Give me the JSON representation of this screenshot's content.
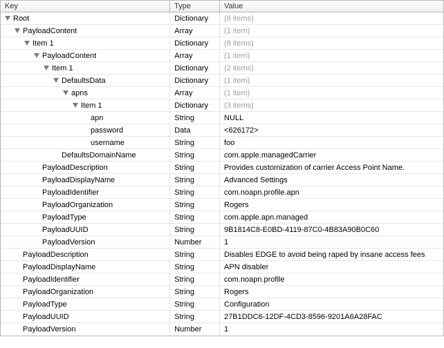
{
  "columns": {
    "key": "Key",
    "type": "Type",
    "value": "Value"
  },
  "rows": [
    {
      "depth": 0,
      "disclosure": true,
      "key": "Root",
      "type": "Dictionary",
      "value": "(8 items)",
      "placeholder": true
    },
    {
      "depth": 1,
      "disclosure": true,
      "key": "PayloadContent",
      "type": "Array",
      "value": "(1 item)",
      "placeholder": true
    },
    {
      "depth": 2,
      "disclosure": true,
      "key": "Item 1",
      "type": "Dictionary",
      "value": "(8 items)",
      "placeholder": true
    },
    {
      "depth": 3,
      "disclosure": true,
      "key": "PayloadContent",
      "type": "Array",
      "value": "(1 item)",
      "placeholder": true
    },
    {
      "depth": 4,
      "disclosure": true,
      "key": "Item 1",
      "type": "Dictionary",
      "value": "(2 items)",
      "placeholder": true
    },
    {
      "depth": 5,
      "disclosure": true,
      "key": "DefaultsData",
      "type": "Dictionary",
      "value": "(1 item)",
      "placeholder": true
    },
    {
      "depth": 6,
      "disclosure": true,
      "key": "apns",
      "type": "Array",
      "value": "(1 item)",
      "placeholder": true
    },
    {
      "depth": 7,
      "disclosure": true,
      "key": "Item 1",
      "type": "Dictionary",
      "value": "(3 items)",
      "placeholder": true
    },
    {
      "depth": 8,
      "disclosure": false,
      "key": "apn",
      "type": "String",
      "value": "NULL",
      "placeholder": false
    },
    {
      "depth": 8,
      "disclosure": false,
      "key": "password",
      "type": "Data",
      "value": "<626172>",
      "placeholder": false
    },
    {
      "depth": 8,
      "disclosure": false,
      "key": "username",
      "type": "String",
      "value": "foo",
      "placeholder": false
    },
    {
      "depth": 5,
      "disclosure": false,
      "key": "DefaultsDomainName",
      "type": "String",
      "value": "com.apple.managedCarrier",
      "placeholder": false
    },
    {
      "depth": 3,
      "disclosure": false,
      "key": "PayloadDescription",
      "type": "String",
      "value": "Provides customization of carrier Access Point Name.",
      "placeholder": false
    },
    {
      "depth": 3,
      "disclosure": false,
      "key": "PayloadDisplayName",
      "type": "String",
      "value": "Advanced Settings",
      "placeholder": false
    },
    {
      "depth": 3,
      "disclosure": false,
      "key": "PayloadIdentifier",
      "type": "String",
      "value": "com.noapn.profile.apn",
      "placeholder": false
    },
    {
      "depth": 3,
      "disclosure": false,
      "key": "PayloadOrganization",
      "type": "String",
      "value": "Rogers",
      "placeholder": false
    },
    {
      "depth": 3,
      "disclosure": false,
      "key": "PayloadType",
      "type": "String",
      "value": "com.apple.apn.managed",
      "placeholder": false
    },
    {
      "depth": 3,
      "disclosure": false,
      "key": "PayloadUUID",
      "type": "String",
      "value": "9B1814C8-E0BD-4119-87C0-4B83A90B0C60",
      "placeholder": false
    },
    {
      "depth": 3,
      "disclosure": false,
      "key": "PayloadVersion",
      "type": "Number",
      "value": "1",
      "placeholder": false
    },
    {
      "depth": 1,
      "disclosure": false,
      "key": "PayloadDescription",
      "type": "String",
      "value": "Disables EDGE to avoid being raped by insane access fees",
      "placeholder": false
    },
    {
      "depth": 1,
      "disclosure": false,
      "key": "PayloadDisplayName",
      "type": "String",
      "value": "APN disabler",
      "placeholder": false
    },
    {
      "depth": 1,
      "disclosure": false,
      "key": "PayloadIdentifier",
      "type": "String",
      "value": "com.noapn.profile",
      "placeholder": false
    },
    {
      "depth": 1,
      "disclosure": false,
      "key": "PayloadOrganization",
      "type": "String",
      "value": "Rogers",
      "placeholder": false
    },
    {
      "depth": 1,
      "disclosure": false,
      "key": "PayloadType",
      "type": "String",
      "value": "Configuration",
      "placeholder": false
    },
    {
      "depth": 1,
      "disclosure": false,
      "key": "PayloadUUID",
      "type": "String",
      "value": "27B1DDC6-12DF-4CD3-8596-9201A6A28FAC",
      "placeholder": false
    },
    {
      "depth": 1,
      "disclosure": false,
      "key": "PayloadVersion",
      "type": "Number",
      "value": "1",
      "placeholder": false
    }
  ]
}
